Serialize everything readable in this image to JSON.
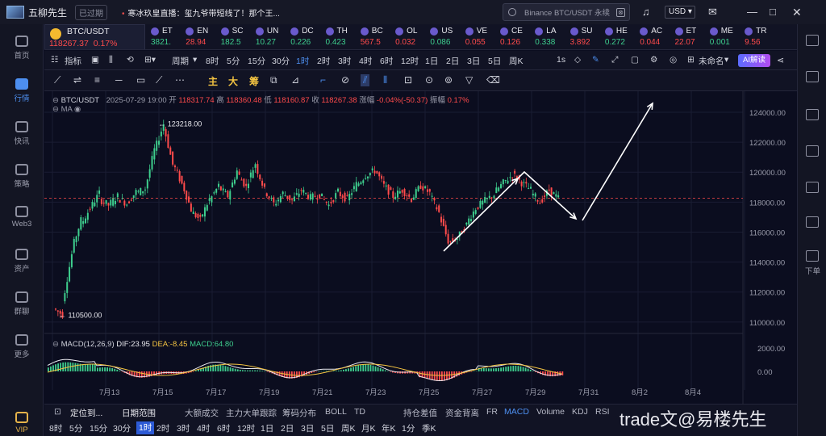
{
  "titlebar": {
    "app_name": "五柳先生",
    "expired": "已过期",
    "ticker": "寒冰玖皇直播：玺九爷带短线了！那个王...",
    "search_placeholder": "Binance BTC/USDT 永续",
    "currency": "USD"
  },
  "leftnav": [
    {
      "label": "首页",
      "icon": "home-icon"
    },
    {
      "label": "行情",
      "icon": "chart-bar-icon",
      "active": true
    },
    {
      "label": "快讯",
      "icon": "news-icon"
    },
    {
      "label": "策略",
      "icon": "robot-icon"
    },
    {
      "label": "Web3",
      "icon": "web3-icon"
    },
    {
      "label": "资产",
      "icon": "wallet-icon"
    },
    {
      "label": "群聊",
      "icon": "chat-icon"
    },
    {
      "label": "更多",
      "icon": "grid-icon"
    },
    {
      "label": "VIP",
      "icon": "vip-icon"
    }
  ],
  "rightnav": {
    "label": "下单"
  },
  "main_symbol": {
    "name": "BTC/USDT",
    "price": "118267.37",
    "change": "0.17%"
  },
  "symbols": [
    {
      "name": "ET",
      "value": "3821.",
      "color": "#3ecf8e"
    },
    {
      "name": "EN",
      "value": "28.94",
      "color": "#ff4b4b"
    },
    {
      "name": "SC",
      "value": "182.5",
      "color": "#3ecf8e"
    },
    {
      "name": "UN",
      "value": "10.27",
      "color": "#3ecf8e"
    },
    {
      "name": "DC",
      "value": "0.226",
      "color": "#3ecf8e"
    },
    {
      "name": "TH",
      "value": "0.423",
      "color": "#3ecf8e"
    },
    {
      "name": "BC",
      "value": "567.5",
      "color": "#ff4b4b"
    },
    {
      "name": "OL",
      "value": "0.032",
      "color": "#ff4b4b"
    },
    {
      "name": "US",
      "value": "0.086",
      "color": "#3ecf8e"
    },
    {
      "name": "VE",
      "value": "0.055",
      "color": "#ff4b4b"
    },
    {
      "name": "CE",
      "value": "0.126",
      "color": "#ff4b4b"
    },
    {
      "name": "LA",
      "value": "0.338",
      "color": "#3ecf8e"
    },
    {
      "name": "SU",
      "value": "3.892",
      "color": "#ff4b4b"
    },
    {
      "name": "HE",
      "value": "0.272",
      "color": "#3ecf8e"
    },
    {
      "name": "AC",
      "value": "0.044",
      "color": "#ff4b4b"
    },
    {
      "name": "ET",
      "value": "22.07",
      "color": "#ff4b4b"
    },
    {
      "name": "ME",
      "value": "0.001",
      "color": "#3ecf8e"
    },
    {
      "name": "TR",
      "value": "9.56",
      "color": "#ff4b4b"
    }
  ],
  "toolbar1": {
    "indicators": "指标",
    "period": "周期",
    "intervals": [
      "8时",
      "5分",
      "15分",
      "30分",
      "1时",
      "2时",
      "3时",
      "4时",
      "6时",
      "12时",
      "1日",
      "2日",
      "3日",
      "5日",
      "周K"
    ],
    "selected_interval": "1时",
    "right_interval": "1s",
    "layout_name": "未命名",
    "ai_button": "AI解读"
  },
  "toolbar2": {
    "zhu": "主",
    "da": "大",
    "chou": "筹"
  },
  "chart_info": {
    "symbol": "BTC/USDT",
    "date": "2025-07-29 19:00",
    "open_label": "开",
    "open": "118317.74",
    "high_label": "高",
    "high": "118360.48",
    "low_label": "低",
    "low": "118160.87",
    "close_label": "收",
    "close": "118267.38",
    "change_label": "涨幅",
    "change": "-0.04%(-50.37)",
    "amp_label": "振幅",
    "amp": "0.17%",
    "ma_label": "MA"
  },
  "macd_info": {
    "label": "MACD(12,26,9)",
    "dif": "DIF:23.95",
    "dea": "DEA:-8.45",
    "macd": "MACD:64.80"
  },
  "chart_data": {
    "type": "candlestick",
    "yaxis_ticks": [
      "124000.00",
      "122000.00",
      "120000.00",
      "118000.00",
      "116000.00",
      "114000.00",
      "112000.00",
      "110000.00"
    ],
    "ylim": [
      109400,
      125400
    ],
    "xaxis_ticks": [
      "7月13",
      "7月15",
      "7月17",
      "7月19",
      "7月21",
      "7月23",
      "7月25",
      "7月27",
      "7月29",
      "7月31",
      "8月2",
      "8月4"
    ],
    "macd_ticks": [
      "2000.00",
      "0.00"
    ],
    "high_annotation": "123218.00",
    "low_annotation": "110500.00",
    "current_price_line": 118267,
    "price_path": [
      [
        110900,
        110500
      ],
      [
        111300,
        114500
      ],
      [
        114800,
        116800
      ],
      [
        116500,
        117600
      ],
      [
        117600,
        118600
      ],
      [
        118200,
        117800
      ],
      [
        117800,
        118400
      ],
      [
        118300,
        117900
      ],
      [
        117900,
        118700
      ],
      [
        118600,
        118900
      ],
      [
        118900,
        121500
      ],
      [
        121400,
        123218
      ],
      [
        123100,
        120500
      ],
      [
        120600,
        119200
      ],
      [
        119300,
        117500
      ],
      [
        117400,
        116800
      ],
      [
        116900,
        118200
      ],
      [
        118100,
        119100
      ],
      [
        119000,
        118400
      ],
      [
        118400,
        120100
      ],
      [
        120000,
        119000
      ],
      [
        119100,
        120600
      ],
      [
        120500,
        118800
      ],
      [
        118800,
        117900
      ],
      [
        117800,
        118600
      ],
      [
        118600,
        118100
      ],
      [
        118100,
        118800
      ],
      [
        118800,
        118300
      ],
      [
        118300,
        118500
      ],
      [
        118500,
        117800
      ],
      [
        117800,
        118700
      ],
      [
        118600,
        118200
      ],
      [
        118200,
        119200
      ],
      [
        119100,
        119800
      ],
      [
        119800,
        120100
      ],
      [
        120200,
        119100
      ],
      [
        119100,
        118400
      ],
      [
        118400,
        118800
      ],
      [
        118800,
        118200
      ],
      [
        118200,
        119100
      ],
      [
        119100,
        118600
      ],
      [
        118500,
        117300
      ],
      [
        117200,
        115400
      ],
      [
        115300,
        115600
      ],
      [
        115600,
        116500
      ],
      [
        116600,
        117600
      ],
      [
        117600,
        118100
      ],
      [
        118100,
        118500
      ],
      [
        118600,
        119300
      ],
      [
        119300,
        119800
      ],
      [
        119900,
        119300
      ],
      [
        119300,
        118800
      ],
      [
        118700,
        118000
      ],
      [
        118000,
        118800
      ],
      [
        118800,
        118267
      ]
    ],
    "annotation_lines": "drawn-arrows",
    "macd_series": "MACD(12,26,9)"
  },
  "bottombar1": {
    "items": [
      "定位到...",
      "日期范围",
      "大额成交",
      "主力大单跟踪",
      "筹码分布",
      "BOLL",
      "TD",
      "持仓差值",
      "资金背离",
      "FR",
      "MACD",
      "Volume",
      "KDJ",
      "RSI"
    ],
    "selected": "MACD"
  },
  "bottombar2": {
    "intervals": [
      "8时",
      "5分",
      "15分",
      "30分",
      "1时",
      "2时",
      "3时",
      "4时",
      "6时",
      "12时",
      "1日",
      "2日",
      "3日",
      "5日",
      "周K",
      "月K",
      "年K",
      "1分",
      "季K"
    ],
    "selected": "1时"
  },
  "watermark": "trade文@易楼先生",
  "colors": {
    "up": "#3ecf8e",
    "down": "#ff4b4b",
    "accent": "#4d8ff0",
    "bg": "#0b0d1f"
  }
}
